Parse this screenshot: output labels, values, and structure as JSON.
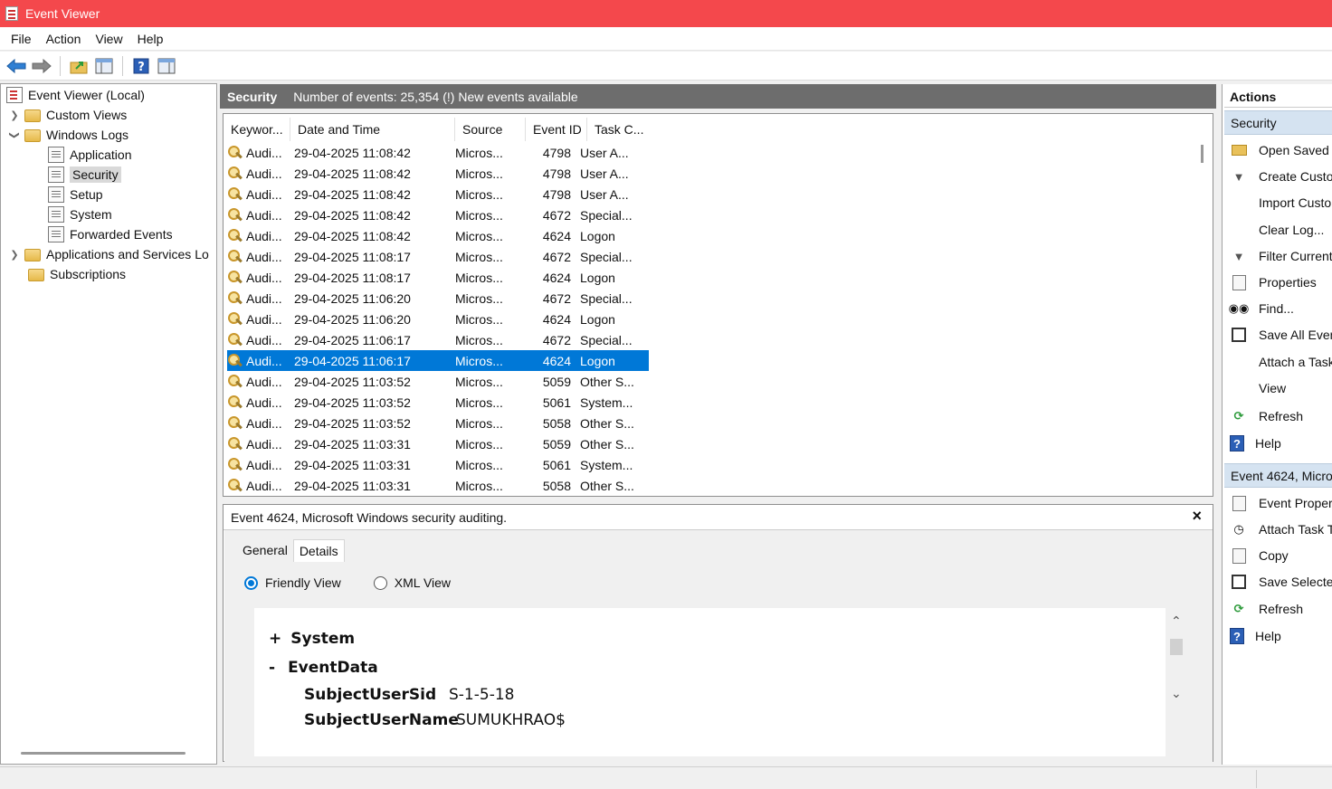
{
  "window": {
    "title": "Event Viewer"
  },
  "menu": [
    "File",
    "Action",
    "View",
    "Help"
  ],
  "toolbar": {
    "icons": [
      "back-arrow-icon",
      "forward-arrow-icon",
      "folder-up-icon",
      "show-hide-tree-icon",
      "help-icon",
      "show-hide-action-pane-icon"
    ]
  },
  "tree": {
    "root": "Event Viewer (Local)",
    "custom_views": "Custom Views",
    "windows_logs": "Windows Logs",
    "logs": [
      "Application",
      "Security",
      "Setup",
      "System",
      "Forwarded Events"
    ],
    "apps_services": "Applications and Services Lo",
    "subscriptions": "Subscriptions"
  },
  "center": {
    "log_name": "Security",
    "summary": "Number of events: 25,354 (!) New events available",
    "columns": [
      "Keywor...",
      "Date and Time",
      "Source",
      "Event ID",
      "Task C..."
    ],
    "rows": [
      [
        "Audi...",
        "29-04-2025 11:08:42",
        "Micros...",
        "4798",
        "User A..."
      ],
      [
        "Audi...",
        "29-04-2025 11:08:42",
        "Micros...",
        "4798",
        "User A..."
      ],
      [
        "Audi...",
        "29-04-2025 11:08:42",
        "Micros...",
        "4798",
        "User A..."
      ],
      [
        "Audi...",
        "29-04-2025 11:08:42",
        "Micros...",
        "4672",
        "Special..."
      ],
      [
        "Audi...",
        "29-04-2025 11:08:42",
        "Micros...",
        "4624",
        "Logon"
      ],
      [
        "Audi...",
        "29-04-2025 11:08:17",
        "Micros...",
        "4672",
        "Special..."
      ],
      [
        "Audi...",
        "29-04-2025 11:08:17",
        "Micros...",
        "4624",
        "Logon"
      ],
      [
        "Audi...",
        "29-04-2025 11:06:20",
        "Micros...",
        "4672",
        "Special..."
      ],
      [
        "Audi...",
        "29-04-2025 11:06:20",
        "Micros...",
        "4624",
        "Logon"
      ],
      [
        "Audi...",
        "29-04-2025 11:06:17",
        "Micros...",
        "4672",
        "Special..."
      ],
      [
        "Audi...",
        "29-04-2025 11:06:17",
        "Micros...",
        "4624",
        "Logon"
      ],
      [
        "Audi...",
        "29-04-2025 11:03:52",
        "Micros...",
        "5059",
        "Other S..."
      ],
      [
        "Audi...",
        "29-04-2025 11:03:52",
        "Micros...",
        "5061",
        "System..."
      ],
      [
        "Audi...",
        "29-04-2025 11:03:52",
        "Micros...",
        "5058",
        "Other S..."
      ],
      [
        "Audi...",
        "29-04-2025 11:03:31",
        "Micros...",
        "5059",
        "Other S..."
      ],
      [
        "Audi...",
        "29-04-2025 11:03:31",
        "Micros...",
        "5061",
        "System..."
      ],
      [
        "Audi...",
        "29-04-2025 11:03:31",
        "Micros...",
        "5058",
        "Other S..."
      ]
    ],
    "selected_row": 10
  },
  "detail": {
    "title": "Event 4624, Microsoft Windows security auditing.",
    "close": "×",
    "tabs": [
      "General",
      "Details"
    ],
    "radio_friendly": "Friendly View",
    "radio_xml": "XML View",
    "system_sign": "+",
    "system": "System",
    "eventdata_sign": "-",
    "eventdata": "EventData",
    "fields": [
      {
        "name": "SubjectUserSid",
        "value": "S-1-5-18"
      },
      {
        "name": "SubjectUserName",
        "value": "SUMUKHRAO$"
      }
    ]
  },
  "actions": {
    "header": "Actions",
    "section1": "Security",
    "items1": [
      "Open Saved I",
      "Create Custo",
      "Import Custo",
      "Clear Log...",
      "Filter Current",
      "Properties",
      "Find...",
      "Save All Even",
      "Attach a Task",
      "View",
      "Refresh",
      "Help"
    ],
    "section2": "Event 4624, Micro",
    "items2": [
      "Event Proper",
      "Attach Task T",
      "Copy",
      "Save Selected",
      "Refresh",
      "Help"
    ]
  }
}
